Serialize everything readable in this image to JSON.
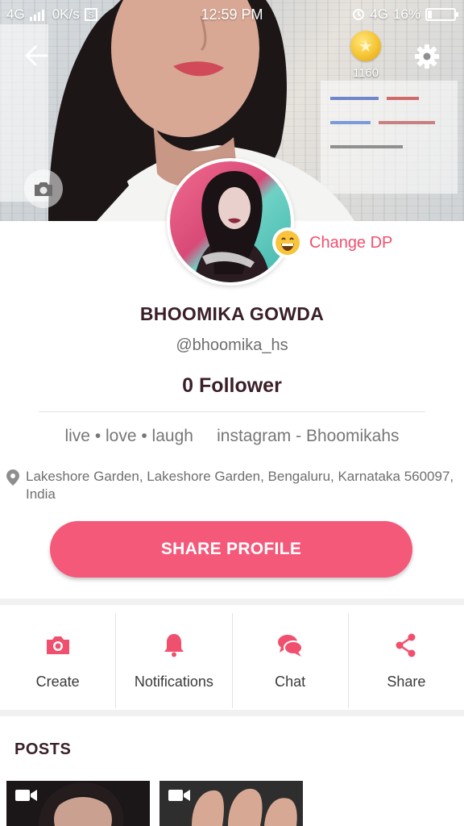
{
  "status_bar": {
    "network_left": "4G",
    "speed": "0K/s",
    "time": "12:59 PM",
    "network_right": "4G",
    "battery": "16%"
  },
  "header": {
    "coin_count": "1160"
  },
  "profile": {
    "change_dp_label": "Change DP",
    "name": "BHOOMIKA GOWDA",
    "handle": "@bhoomika_hs",
    "followers": "0 Follower",
    "bio": "live • love • laugh     instagram - Bhoomikahs",
    "location": "Lakeshore Garden, Lakeshore Garden, Bengaluru, Karnataka 560097, India",
    "share_button": "SHARE PROFILE"
  },
  "actions": [
    {
      "label": "Create",
      "icon": "camera-icon"
    },
    {
      "label": "Notifications",
      "icon": "bell-icon"
    },
    {
      "label": "Chat",
      "icon": "chat-icon"
    },
    {
      "label": "Share",
      "icon": "share-icon"
    }
  ],
  "posts": {
    "title": "POSTS"
  },
  "colors": {
    "accent": "#f5597a",
    "dark_text": "#3a1f26"
  }
}
